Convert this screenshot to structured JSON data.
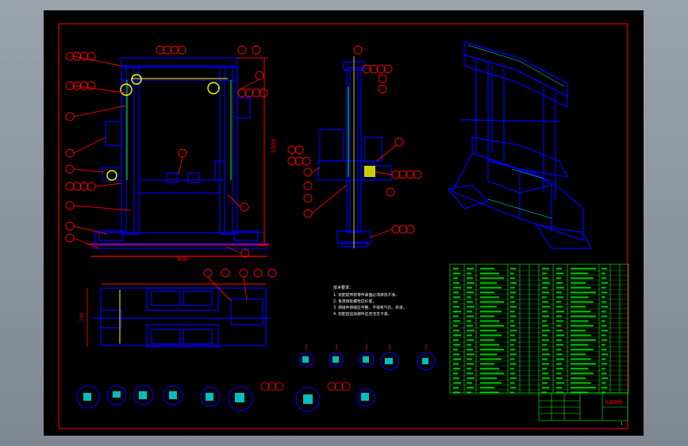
{
  "colors": {
    "background": "#000000",
    "frame": "#ff0000",
    "geometry": "#0000ff",
    "hatch": "#00ffff",
    "parts_table": "#00ff00",
    "centerline": "#ffff00",
    "white": "#ffffff"
  },
  "dimensions": {
    "width_label": "900",
    "height_label": "2300",
    "plan_label": "700"
  },
  "notes": {
    "title": "技术要求：",
    "lines": [
      "1. 装配前所有零件表面必须清洗干净，",
      "2. 各连接处螺栓应拧紧，",
      "3. 焊接件焊缝应平整，不得有气孔、夹渣，",
      "4. 装配后运动部件应灵活无卡滞。"
    ]
  },
  "title_block": {
    "drawing_title": "总装配图",
    "sheet": "1"
  }
}
